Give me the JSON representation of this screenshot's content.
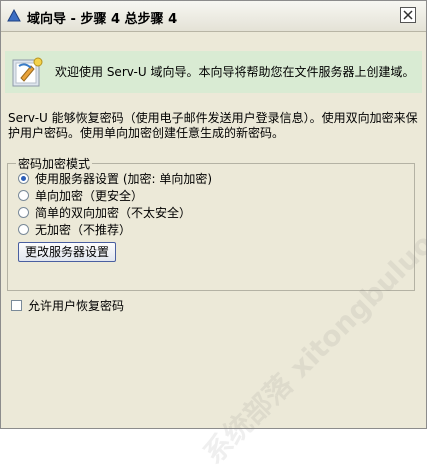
{
  "window": {
    "title": "域向导 - 步骤 4 总步骤 4"
  },
  "banner": {
    "text": "欢迎使用 Serv-U 域向导。本向导将帮助您在文件服务器上创建域。"
  },
  "description": "Serv-U 能够恢复密码（使用电子邮件发送用户登录信息）。使用双向加密来保护用户密码。使用单向加密创建任意生成的新密码。",
  "encryption": {
    "legend": "密码加密模式",
    "options": [
      {
        "label": "使用服务器设置 (加密: 单向加密)",
        "checked": true
      },
      {
        "label": "单向加密（更安全）",
        "checked": false
      },
      {
        "label": "简单的双向加密（不太安全）",
        "checked": false
      },
      {
        "label": "无加密（不推荐）",
        "checked": false
      }
    ],
    "change_button": "更改服务器设置"
  },
  "allow_recovery": {
    "label": "允许用户恢复密码",
    "checked": false
  },
  "watermark": "系统部落 xitongbuluo.com"
}
